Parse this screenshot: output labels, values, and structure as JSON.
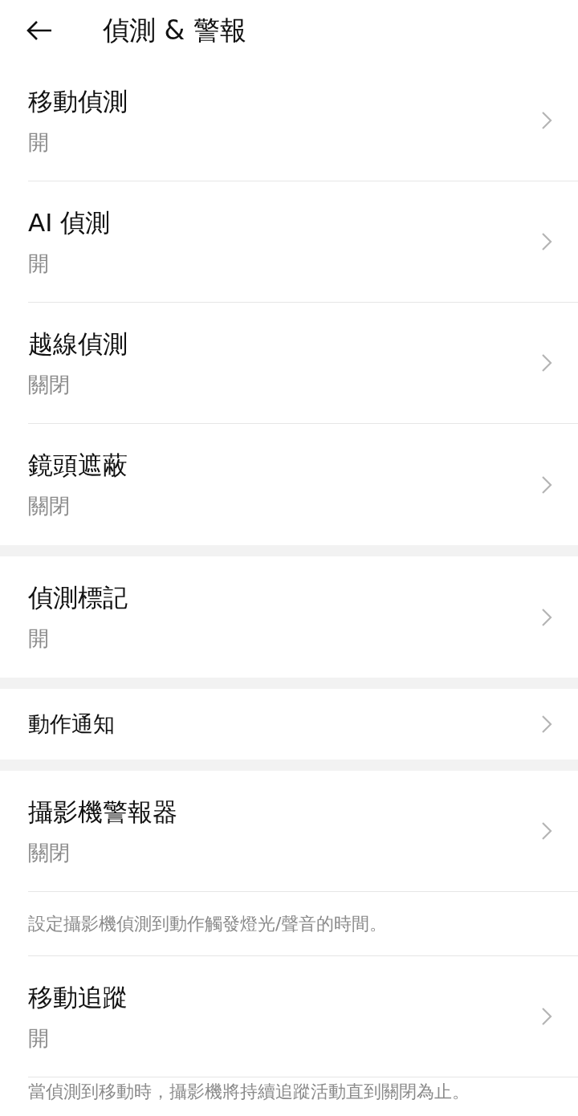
{
  "header": {
    "title": "偵測 & 警報"
  },
  "sections": [
    {
      "items": [
        {
          "kind": "setting",
          "title": "移動偵測",
          "value": "開"
        },
        {
          "kind": "setting",
          "title": "AI 偵測",
          "value": "開"
        },
        {
          "kind": "setting",
          "title": "越線偵測",
          "value": "關閉"
        },
        {
          "kind": "setting",
          "title": "鏡頭遮蔽",
          "value": "關閉"
        }
      ]
    },
    {
      "items": [
        {
          "kind": "setting",
          "title": "偵測標記",
          "value": "開"
        }
      ]
    },
    {
      "items": [
        {
          "kind": "link",
          "title": "動作通知"
        }
      ]
    },
    {
      "items": [
        {
          "kind": "setting",
          "title": "攝影機警報器",
          "value": "關閉"
        },
        {
          "kind": "note",
          "text": "設定攝影機偵測到動作觸發燈光/聲音的時間。"
        },
        {
          "kind": "setting",
          "title": "移動追蹤",
          "value": "開"
        },
        {
          "kind": "note",
          "text": "當偵測到移動時，攝影機將持續追蹤活動直到關閉為止。"
        }
      ]
    }
  ]
}
